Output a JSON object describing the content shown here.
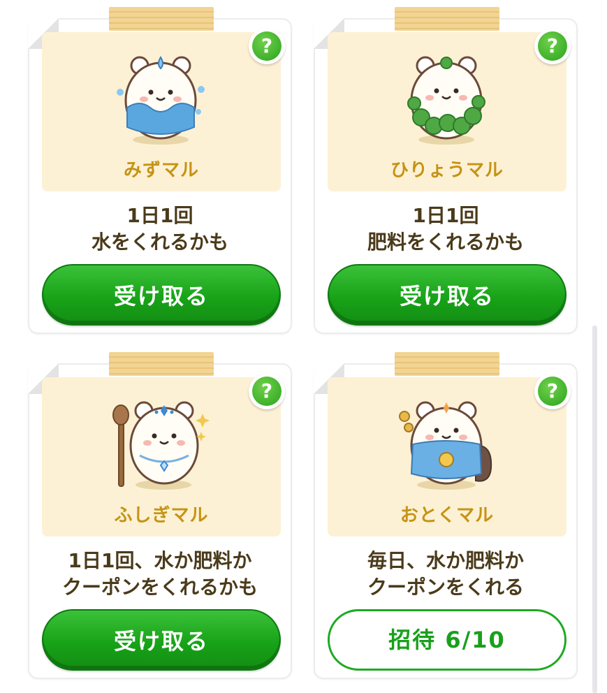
{
  "cards": [
    {
      "name": "みずマル",
      "desc_line1": "1日1回",
      "desc_line2": "水をくれるかも",
      "button": "受け取る",
      "button_style": "primary",
      "accent_color": "#5aa7e0",
      "character_icon": "water-hamster-icon"
    },
    {
      "name": "ひりょうマル",
      "desc_line1": "1日1回",
      "desc_line2": "肥料をくれるかも",
      "button": "受け取る",
      "button_style": "primary",
      "accent_color": "#4fa844",
      "character_icon": "fertilizer-hamster-icon"
    },
    {
      "name": "ふしぎマル",
      "desc_line1": "1日1回、水か肥料か",
      "desc_line2": "クーポンをくれるかも",
      "button": "受け取る",
      "button_style": "primary",
      "accent_color": "#3d8ad6",
      "character_icon": "mystery-hamster-icon"
    },
    {
      "name": "おとくマル",
      "desc_line1": "毎日、水か肥料か",
      "desc_line2": "クーポンをくれる",
      "button": "招待 6/10",
      "button_style": "outline",
      "accent_color": "#d9a431",
      "character_icon": "bargain-hamster-icon"
    }
  ],
  "help_label": "?",
  "colors": {
    "primary_green": "#1aa31b",
    "name_gold": "#c59414",
    "panel_cream": "#fdf1d5"
  }
}
